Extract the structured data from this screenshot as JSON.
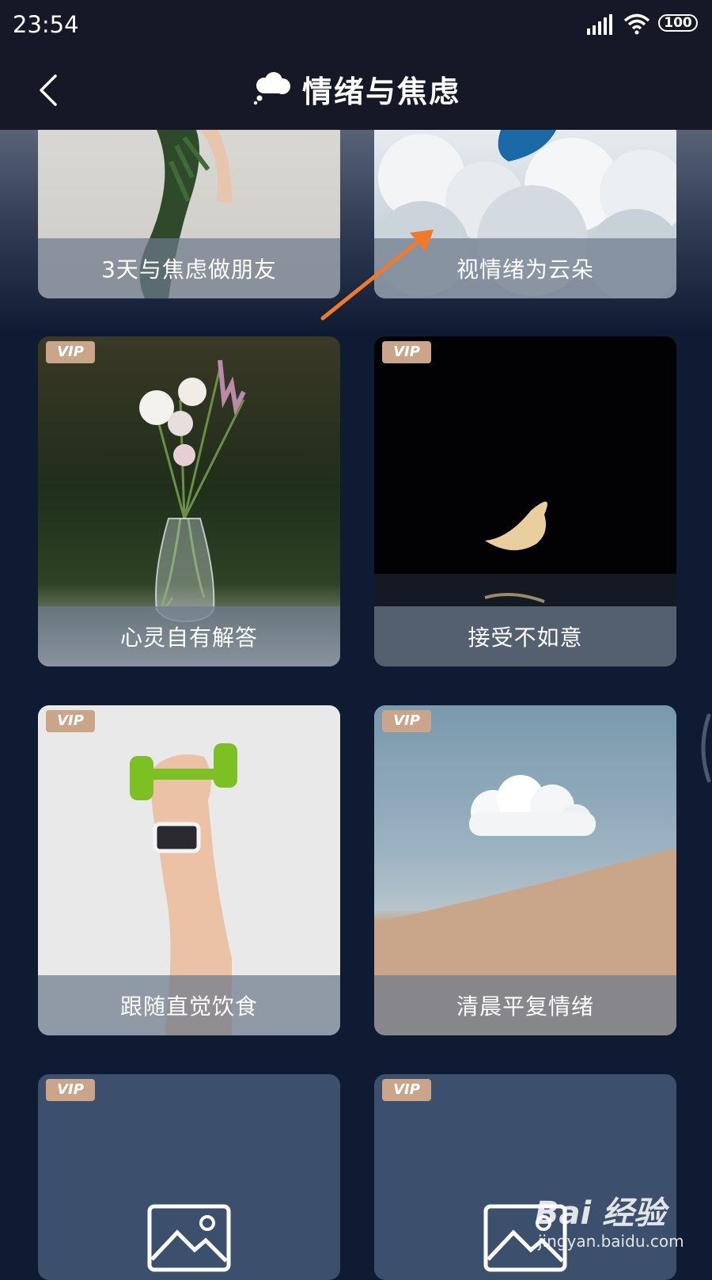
{
  "status_bar": {
    "time": "23:54",
    "battery": "100"
  },
  "header": {
    "title": "情绪与焦虑",
    "icon": "thought-cloud-icon"
  },
  "cards": [
    {
      "label": "3天与焦虑做朋友",
      "vip": ""
    },
    {
      "label": "视情绪为云朵",
      "vip": ""
    },
    {
      "label": "心灵自有解答",
      "vip": "VIP"
    },
    {
      "label": "接受不如意",
      "vip": "VIP"
    },
    {
      "label": "跟随直觉饮食",
      "vip": "VIP"
    },
    {
      "label": "清晨平复情绪",
      "vip": "VIP"
    },
    {
      "label": "",
      "vip": "VIP"
    },
    {
      "label": "",
      "vip": "VIP"
    }
  ],
  "watermark": {
    "logo": "Bai 经验",
    "site": "jingyan.baidu.com"
  },
  "colors": {
    "background": "#0f1b33",
    "header": "#161828",
    "vip_badge": "#caa589",
    "arrow": "#f07a2a"
  }
}
